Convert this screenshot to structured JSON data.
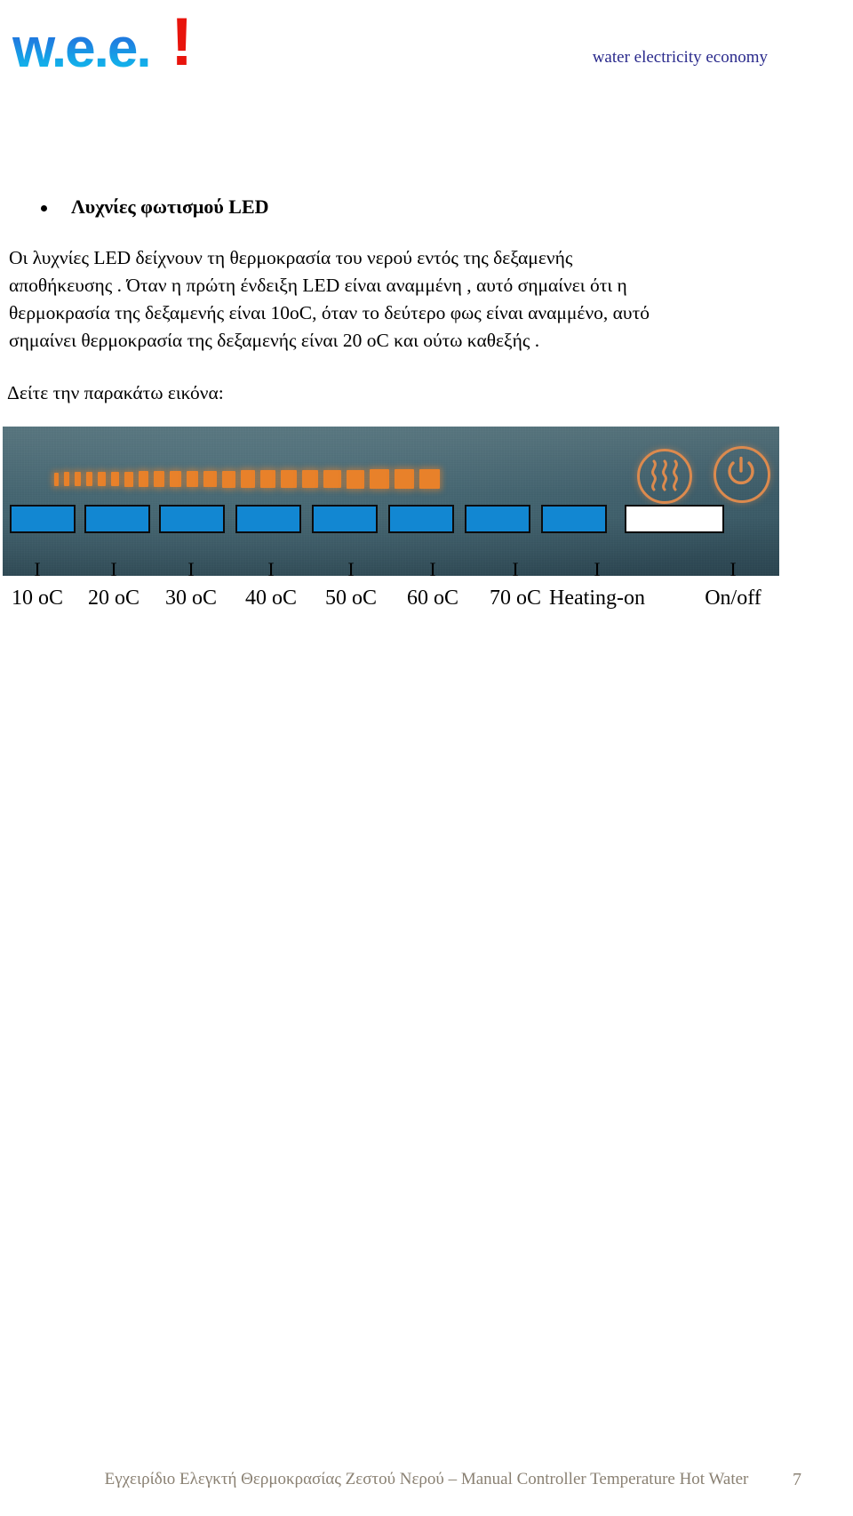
{
  "header": {
    "logo_word": "w.e.e.",
    "logo_bang": "!",
    "logo_colors": {
      "blue": "#1b5fd9",
      "cyan": "#0fc6f2",
      "red": "#e8140c"
    },
    "tagline": "water electricity economy",
    "tagline_color": "#2a2a8c"
  },
  "content": {
    "heading": "Λυχνίες φωτισμού LED",
    "paragraph_lines": [
      "Οι λυχνίες LED δείχνουν τη θερμοκρασία του νερού εντός της δεξαμενής",
      "αποθήκευσης . Όταν η πρώτη ένδειξη LED είναι αναμμένη , αυτό σημαίνει ότι η",
      "θερμοκρασία της δεξαμενής είναι 10oC, όταν το δεύτερο φως είναι αναμμένο, αυτό",
      "σημαίνει θερμοκρασία της δεξαμενής είναι 20 oC και ούτω καθεξής ."
    ],
    "see_image": "Δείτε την παρακάτω εικόνα:"
  },
  "figure": {
    "panel_color": "#3a5a66",
    "led_color": "#e8812a",
    "icon_color": "#dc8a4e",
    "marker_fill": "#1287d2",
    "led_count": 22,
    "icons": [
      {
        "name": "heating-waves-icon"
      },
      {
        "name": "power-on-off-icon"
      }
    ],
    "markers": [
      {
        "state": "filled"
      },
      {
        "state": "filled"
      },
      {
        "state": "filled"
      },
      {
        "state": "filled"
      },
      {
        "state": "filled"
      },
      {
        "state": "filled"
      },
      {
        "state": "filled"
      },
      {
        "state": "filled"
      },
      {
        "state": "empty"
      }
    ],
    "tick_symbol": "I",
    "ticks": [
      "I",
      "I",
      "I",
      "I",
      "I",
      "I",
      "I",
      "I",
      "I"
    ],
    "labels": [
      "10 oC",
      "20 oC",
      "30 oC",
      "40 oC",
      "50 oC",
      "60 oC",
      "70 oC",
      "Heating-on",
      "On/off"
    ]
  },
  "footer": {
    "text": "Εγχειρίδιο Ελεγκτή Θερμοκρασίας Ζεστού Νερού – Manual Controller Temperature Hot Water",
    "page": "7",
    "color": "#8a8173"
  }
}
